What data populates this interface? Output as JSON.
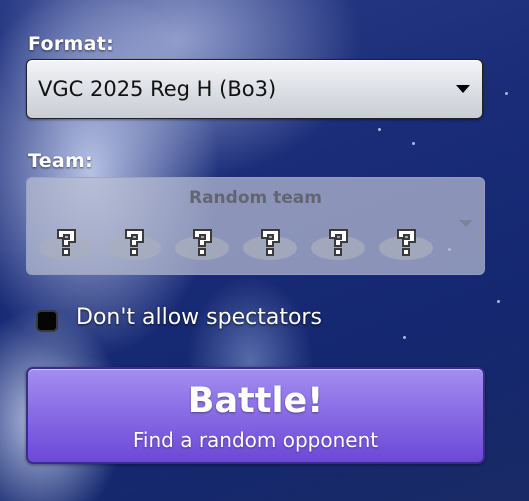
{
  "format": {
    "label": "Format:",
    "selected": "VGC 2025 Reg H (Bo3)"
  },
  "team": {
    "label": "Team:",
    "selected": "Random team",
    "slot_icon": "question-mark-icon"
  },
  "options": {
    "no_spectators_label": "Don't allow spectators",
    "no_spectators_checked": false
  },
  "battle": {
    "title": "Battle!",
    "subtitle": "Find a random opponent"
  },
  "colors": {
    "battle_button": "#8a6de6",
    "background": "#1a2c78"
  }
}
